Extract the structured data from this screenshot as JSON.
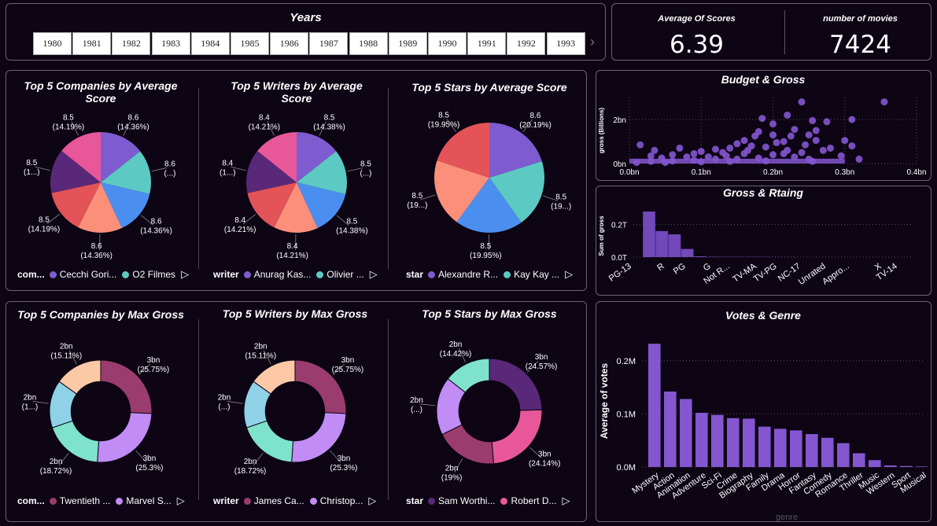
{
  "slicer": {
    "title": "Years",
    "years": [
      "1980",
      "1981",
      "1982",
      "1983",
      "1984",
      "1985",
      "1986",
      "1987",
      "1988",
      "1989",
      "1990",
      "1991",
      "1992",
      "1993"
    ],
    "next_icon": "chevron-right-icon"
  },
  "kpis": {
    "avg_score_label": "Average Of Scores",
    "avg_score_value": "6.39",
    "movies_label": "number of movies",
    "movies_value": "7424"
  },
  "colors": {
    "background": "#0d0414",
    "border": "#6a6472",
    "purple": "#7f5bd0",
    "teal": "#5cc9c2",
    "blue": "#4a8ff0",
    "salmon": "#fb8f7a",
    "red": "#e45357",
    "dark_purple": "#5a2878",
    "pink": "#e8579a",
    "maroon": "#9b3c6e",
    "lavender": "#c18cf5",
    "mint": "#7fe3cc",
    "peach": "#fdc8a6",
    "light_blue": "#8fd2e8",
    "bar": "#8456cf"
  },
  "chart_data": [
    {
      "type": "pie",
      "title": "Top 5 Companies by Average Score",
      "legend_title": "com...",
      "legend_items": [
        "Cecchi Gori...",
        "O2 Filmes"
      ],
      "slices": [
        {
          "value": 8.6,
          "label": "8.6",
          "pct": "(14.36%)",
          "color": "#7f5bd0"
        },
        {
          "value": 8.6,
          "label": "8.6",
          "pct": "(...)",
          "color": "#5cc9c2"
        },
        {
          "value": 8.6,
          "label": "8.6",
          "pct": "(14.36%)",
          "color": "#4a8ff0"
        },
        {
          "value": 8.6,
          "label": "8.6",
          "pct": "(14.36%)",
          "color": "#fb8f7a"
        },
        {
          "value": 8.5,
          "label": "8.5",
          "pct": "(14.19%)",
          "color": "#e45357"
        },
        {
          "value": 8.5,
          "label": "8.5",
          "pct": "(1...)",
          "color": "#5a2878"
        },
        {
          "value": 8.5,
          "label": "8.5",
          "pct": "(14.19%)",
          "color": "#e8579a"
        }
      ]
    },
    {
      "type": "pie",
      "title": "Top 5 Writers by Average Score",
      "legend_title": "writer",
      "legend_items": [
        "Anurag Kas...",
        "Olivier ..."
      ],
      "slices": [
        {
          "value": 8.5,
          "label": "8.5",
          "pct": "(14.38%)",
          "color": "#7f5bd0"
        },
        {
          "value": 8.5,
          "label": "8.5",
          "pct": "(...)",
          "color": "#5cc9c2"
        },
        {
          "value": 8.5,
          "label": "8.5",
          "pct": "(14.38%)",
          "color": "#4a8ff0"
        },
        {
          "value": 8.4,
          "label": "8.4",
          "pct": "(14.21%)",
          "color": "#fb8f7a"
        },
        {
          "value": 8.4,
          "label": "8.4",
          "pct": "(14.21%)",
          "color": "#e45357"
        },
        {
          "value": 8.4,
          "label": "8.4",
          "pct": "(1...)",
          "color": "#5a2878"
        },
        {
          "value": 8.4,
          "label": "8.4",
          "pct": "(14.21%)",
          "color": "#e8579a"
        }
      ]
    },
    {
      "type": "pie",
      "title": "Top 5 Stars by Average Score",
      "legend_title": "star",
      "legend_items": [
        "Alexandre R...",
        "Kay Kay ..."
      ],
      "slices": [
        {
          "value": 8.6,
          "label": "8.6",
          "pct": "(20.19%)",
          "color": "#7f5bd0"
        },
        {
          "value": 8.5,
          "label": "8.5",
          "pct": "(19...)",
          "color": "#5cc9c2"
        },
        {
          "value": 8.5,
          "label": "8.5",
          "pct": "(19.95%)",
          "color": "#4a8ff0"
        },
        {
          "value": 8.5,
          "label": "8.5",
          "pct": "(19...)",
          "color": "#fb8f7a"
        },
        {
          "value": 8.5,
          "label": "8.5",
          "pct": "(19.95%)",
          "color": "#e45357"
        }
      ]
    },
    {
      "type": "pie",
      "donut": true,
      "title": "Top 5 Companies by Max Gross",
      "legend_title": "com...",
      "legend_items": [
        "Twentieth ...",
        "Marvel S..."
      ],
      "slices": [
        {
          "value": 25.75,
          "label": "3bn",
          "pct": "(25.75%)",
          "color": "#9b3c6e"
        },
        {
          "value": 25.3,
          "label": "3bn",
          "pct": "(25.3%)",
          "color": "#c18cf5"
        },
        {
          "value": 18.72,
          "label": "2bn",
          "pct": "(18.72%)",
          "color": "#7fe3cc"
        },
        {
          "value": 15.12,
          "label": "2bn",
          "pct": "(1...)",
          "color": "#8fd2e8"
        },
        {
          "value": 15.11,
          "label": "2bn",
          "pct": "(15.11%)",
          "color": "#fdc8a6"
        }
      ]
    },
    {
      "type": "pie",
      "donut": true,
      "title": "Top 5 Writers by Max Gross",
      "legend_title": "writer",
      "legend_items": [
        "James Ca...",
        "Christop..."
      ],
      "slices": [
        {
          "value": 25.75,
          "label": "3bn",
          "pct": "(25.75%)",
          "color": "#9b3c6e"
        },
        {
          "value": 25.3,
          "label": "3bn",
          "pct": "(25.3%)",
          "color": "#c18cf5"
        },
        {
          "value": 18.72,
          "label": "2bn",
          "pct": "(18.72%)",
          "color": "#7fe3cc"
        },
        {
          "value": 15.12,
          "label": "2bn",
          "pct": "(...)",
          "color": "#8fd2e8"
        },
        {
          "value": 15.11,
          "label": "2bn",
          "pct": "(15.11%)",
          "color": "#fdc8a6"
        }
      ]
    },
    {
      "type": "pie",
      "donut": true,
      "title": "Top 5 Stars by Max Gross",
      "legend_title": "star",
      "legend_items": [
        "Sam Worthi...",
        "Robert D..."
      ],
      "slices": [
        {
          "value": 24.57,
          "label": "3bn",
          "pct": "(24.57%)",
          "color": "#5a2878"
        },
        {
          "value": 24.14,
          "label": "3bn",
          "pct": "(24.14%)",
          "color": "#e8579a"
        },
        {
          "value": 19.0,
          "label": "2bn",
          "pct": "(19%)",
          "color": "#9b3c6e"
        },
        {
          "value": 17.87,
          "label": "2bn",
          "pct": "(...)",
          "color": "#c18cf5"
        },
        {
          "value": 14.42,
          "label": "2bn",
          "pct": "(14.42%)",
          "color": "#7fe3cc"
        }
      ]
    },
    {
      "type": "scatter",
      "title": "Budget & Gross",
      "xlabel": "",
      "ylabel": "gross (Billions)",
      "xlim": [
        0,
        0.4
      ],
      "ylim": [
        0,
        3
      ],
      "xticks": [
        "0.0bn",
        "0.1bn",
        "0.2bn",
        "0.3bn",
        "0.4bn"
      ],
      "yticks": [
        "0bn",
        "2bn"
      ],
      "points": [
        [
          0.355,
          2.8
        ],
        [
          0.24,
          2.8
        ],
        [
          0.22,
          2.2
        ],
        [
          0.185,
          2.05
        ],
        [
          0.2,
          1.8
        ],
        [
          0.255,
          1.95
        ],
        [
          0.275,
          1.9
        ],
        [
          0.31,
          2.0
        ],
        [
          0.26,
          1.5
        ],
        [
          0.25,
          1.3
        ],
        [
          0.23,
          1.55
        ],
        [
          0.3,
          1.05
        ],
        [
          0.31,
          0.8
        ],
        [
          0.225,
          1.25
        ],
        [
          0.175,
          1.25
        ],
        [
          0.18,
          1.45
        ],
        [
          0.2,
          1.3
        ],
        [
          0.16,
          1.05
        ],
        [
          0.15,
          0.9
        ],
        [
          0.205,
          0.95
        ],
        [
          0.245,
          0.85
        ],
        [
          0.215,
          1.0
        ],
        [
          0.26,
          1.05
        ],
        [
          0.27,
          0.6
        ],
        [
          0.28,
          0.7
        ],
        [
          0.24,
          0.5
        ],
        [
          0.22,
          0.6
        ],
        [
          0.19,
          0.75
        ],
        [
          0.17,
          0.8
        ],
        [
          0.14,
          0.7
        ],
        [
          0.12,
          0.65
        ],
        [
          0.1,
          0.55
        ],
        [
          0.13,
          0.5
        ],
        [
          0.09,
          0.45
        ],
        [
          0.06,
          0.4
        ],
        [
          0.03,
          0.35
        ],
        [
          0.015,
          0.85
        ],
        [
          0.045,
          0.25
        ],
        [
          0.08,
          0.3
        ],
        [
          0.11,
          0.3
        ],
        [
          0.16,
          0.45
        ],
        [
          0.2,
          0.4
        ],
        [
          0.23,
          0.3
        ],
        [
          0.18,
          0.25
        ],
        [
          0.15,
          0.2
        ],
        [
          0.12,
          0.2
        ],
        [
          0.09,
          0.15
        ],
        [
          0.06,
          0.12
        ],
        [
          0.03,
          0.1
        ],
        [
          0.01,
          0.05
        ],
        [
          0.05,
          0.05
        ],
        [
          0.1,
          0.08
        ],
        [
          0.14,
          0.1
        ],
        [
          0.19,
          0.12
        ],
        [
          0.25,
          0.2
        ],
        [
          0.035,
          0.6
        ],
        [
          0.07,
          0.7
        ],
        [
          0.135,
          0.35
        ],
        [
          0.165,
          0.6
        ],
        [
          0.215,
          0.45
        ],
        [
          0.295,
          0.35
        ],
        [
          0.255,
          0.1
        ],
        [
          0.32,
          0.2
        ]
      ]
    },
    {
      "type": "area",
      "title": "Gross & Rtaing",
      "xlabel": "",
      "ylabel": "Sum of gross",
      "ylim": [
        0,
        0.3
      ],
      "yticks": [
        "0.0T",
        "0.2T"
      ],
      "categories": [
        "PG-13",
        "R",
        "PG",
        "G",
        "Not R...",
        "TV-MA",
        "TV-PG",
        "NC-17",
        "Unrated",
        "Appro...",
        "X",
        "TV-14"
      ],
      "values": [
        0.28,
        0.16,
        0.14,
        0.05,
        0.005,
        0.002,
        0.001,
        0.001,
        0.001,
        0.001,
        0.0005,
        0.0005
      ]
    },
    {
      "type": "bar",
      "title": "Votes & Genre",
      "xlabel": "genre",
      "ylabel": "Average of votes",
      "ylim": [
        0,
        0.25
      ],
      "yticks": [
        "0.0M",
        "0.1M",
        "0.2M"
      ],
      "categories": [
        "Mystery",
        "Action",
        "Animation",
        "Adventure",
        "Sci-Fi",
        "Crime",
        "Biography",
        "Family",
        "Drama",
        "Horror",
        "Fantasy",
        "Comedy",
        "Romance",
        "Thriller",
        "Music",
        "Western",
        "Sport",
        "Musical"
      ],
      "values": [
        0.232,
        0.142,
        0.128,
        0.102,
        0.098,
        0.092,
        0.091,
        0.076,
        0.072,
        0.069,
        0.062,
        0.055,
        0.045,
        0.026,
        0.013,
        0.003,
        0.002,
        0.001
      ]
    }
  ]
}
